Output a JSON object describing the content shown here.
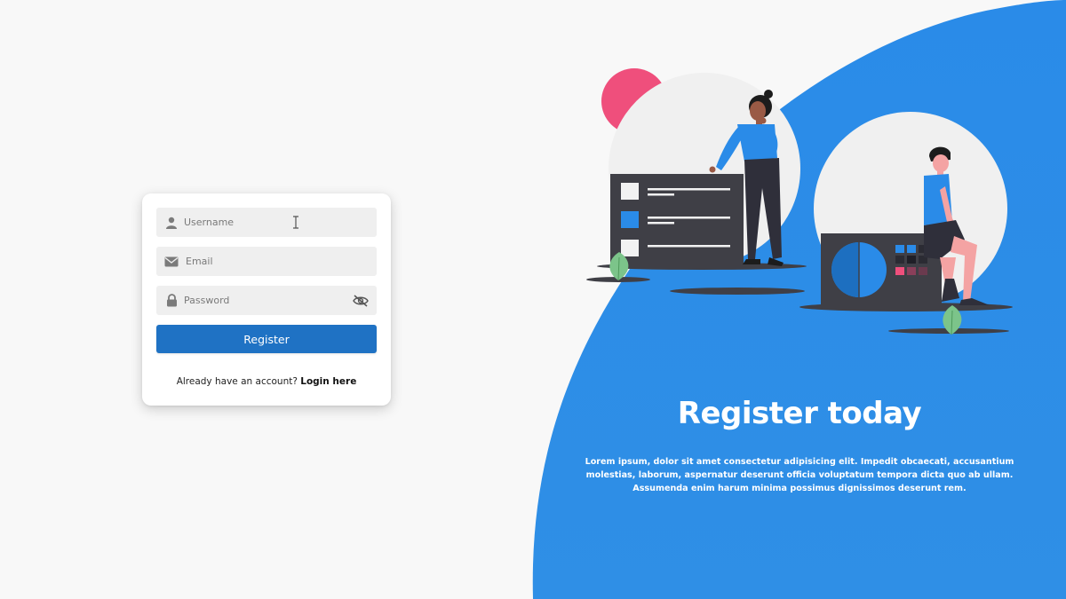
{
  "form": {
    "username_placeholder": "Username",
    "email_placeholder": "Email",
    "password_placeholder": "Password",
    "register_label": "Register",
    "login_prompt": "Already have an account?",
    "login_link": "Login here"
  },
  "hero": {
    "title": "Register today",
    "body": "Lorem ipsum, dolor sit amet consectetur adipisicing elit. Impedit obcaecati, accusantium molestias, laborum, aspernatur deserunt officia voluptatum tempora dicta quo ab ullam. Assumenda enim harum minima possimus dignissimos deserunt rem."
  },
  "colors": {
    "accent": "#2a8be8",
    "button": "#1f72c4",
    "pink": "#ef4f7c",
    "panel": "#3f3f46"
  },
  "icons": {
    "username": "user-icon",
    "email": "envelope-icon",
    "password": "lock-icon",
    "password_toggle": "eye-slash-icon"
  }
}
